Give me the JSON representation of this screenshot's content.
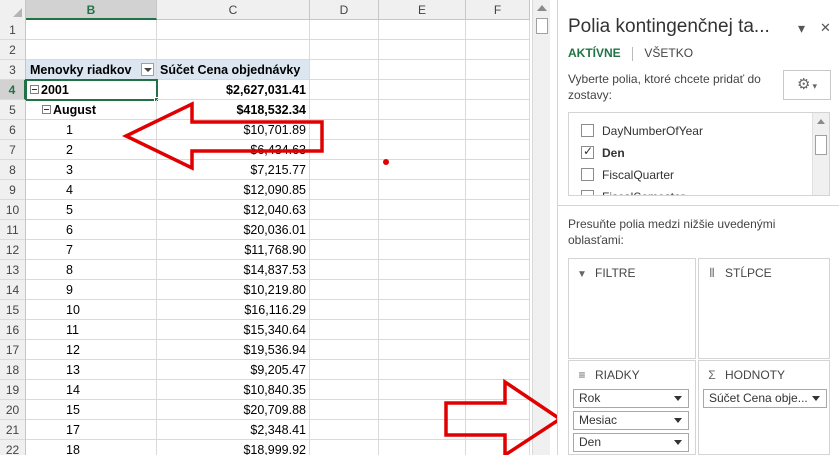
{
  "spreadsheet": {
    "columns": [
      "B",
      "C",
      "D",
      "E",
      "F"
    ],
    "selected_column": "B",
    "rows": [
      {
        "num": "1",
        "b": "",
        "c": ""
      },
      {
        "num": "2",
        "b": "",
        "c": ""
      },
      {
        "num": "3",
        "b": "Menovky riadkov",
        "c": "Súčet Cena objednávky",
        "type": "header"
      },
      {
        "num": "4",
        "b": "2001",
        "c": "$2,627,031.41",
        "type": "year"
      },
      {
        "num": "5",
        "b": "August",
        "c": "$418,532.34",
        "type": "month"
      },
      {
        "num": "6",
        "b": "1",
        "c": "$10,701.89"
      },
      {
        "num": "7",
        "b": "2",
        "c": "$6,434.63"
      },
      {
        "num": "8",
        "b": "3",
        "c": "$7,215.77"
      },
      {
        "num": "9",
        "b": "4",
        "c": "$12,090.85"
      },
      {
        "num": "10",
        "b": "5",
        "c": "$12,040.63"
      },
      {
        "num": "11",
        "b": "6",
        "c": "$20,036.01"
      },
      {
        "num": "12",
        "b": "7",
        "c": "$11,768.90"
      },
      {
        "num": "13",
        "b": "8",
        "c": "$14,837.53"
      },
      {
        "num": "14",
        "b": "9",
        "c": "$10,219.80"
      },
      {
        "num": "15",
        "b": "10",
        "c": "$16,116.29"
      },
      {
        "num": "16",
        "b": "11",
        "c": "$15,340.64"
      },
      {
        "num": "17",
        "b": "12",
        "c": "$19,536.94"
      },
      {
        "num": "18",
        "b": "13",
        "c": "$9,205.47"
      },
      {
        "num": "19",
        "b": "14",
        "c": "$10,840.35"
      },
      {
        "num": "20",
        "b": "15",
        "c": "$20,709.88"
      },
      {
        "num": "21",
        "b": "17",
        "c": "$2,348.41"
      },
      {
        "num": "22",
        "b": "18",
        "c": "$18,999.92"
      }
    ]
  },
  "pane": {
    "title": "Polia kontingenčnej ta...",
    "dropdown_glyph": "▾",
    "close_glyph": "✕",
    "tab_active": "AKTÍVNE",
    "tab_all": "VŠETKO",
    "choose_text": "Vyberte polia, ktoré chcete pridať do zostavy:",
    "gear_icon": "⚙",
    "gear_caret": "▾",
    "fields": [
      {
        "label": "DayNumberOfYear",
        "checked": false,
        "bold": false
      },
      {
        "label": "Den",
        "checked": true,
        "bold": true
      },
      {
        "label": "FiscalQuarter",
        "checked": false,
        "bold": false
      },
      {
        "label": "FiscalSemester",
        "checked": false,
        "bold": false
      }
    ],
    "drag_text": "Presuňte polia medzi nižšie uvedenými oblasťami:",
    "areas": {
      "filters": {
        "label": "FILTRE",
        "icon": "▼"
      },
      "columns": {
        "label": "STĹPCE",
        "icon": "⦀"
      },
      "rows": {
        "label": "RIADKY",
        "icon": "≡",
        "items": [
          "Rok",
          "Mesiac",
          "Den"
        ]
      },
      "values": {
        "label": "HODNOTY",
        "icon": "Σ",
        "items": [
          "Súčet Cena obje..."
        ]
      }
    }
  },
  "colors": {
    "excel_green": "#217346",
    "arrow_red": "#e00000",
    "pivot_header": "#dce6f1"
  }
}
